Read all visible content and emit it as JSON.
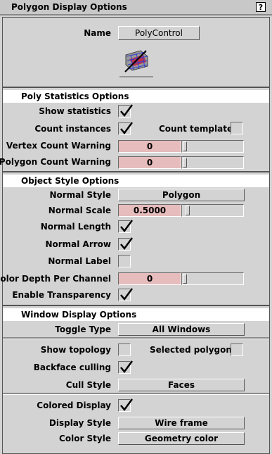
{
  "window": {
    "title": "Polygon Display Options",
    "help_label": "?"
  },
  "name": {
    "label": "Name",
    "value": "PolyControl"
  },
  "poly_stats": {
    "header": "Poly Statistics Options",
    "show_statistics": {
      "label": "Show statistics",
      "checked": true
    },
    "count_instances": {
      "label": "Count instances",
      "checked": true
    },
    "count_templated": {
      "label": "Count templated",
      "checked": false
    },
    "vertex_warning": {
      "label": "Vertex Count Warning",
      "value": "0"
    },
    "polygon_warning": {
      "label": "Polygon Count Warning",
      "value": "0"
    }
  },
  "object_style": {
    "header": "Object Style Options",
    "normal_style": {
      "label": "Normal Style",
      "value": "Polygon"
    },
    "normal_scale": {
      "label": "Normal Scale",
      "value": "0.5000"
    },
    "normal_length": {
      "label": "Normal Length",
      "checked": true
    },
    "normal_arrow": {
      "label": "Normal Arrow",
      "checked": true
    },
    "normal_label": {
      "label": "Normal Label",
      "checked": false
    },
    "color_depth": {
      "label": "Color Depth Per Channel",
      "value": "0"
    },
    "enable_transparency": {
      "label": "Enable Transparency",
      "checked": true
    }
  },
  "window_display": {
    "header": "Window Display Options",
    "toggle_type": {
      "label": "Toggle Type",
      "value": "All Windows"
    },
    "show_topology": {
      "label": "Show topology",
      "checked": false
    },
    "selected_polygons": {
      "label": "Selected polygons",
      "checked": false
    },
    "backface_culling": {
      "label": "Backface culling",
      "checked": true
    },
    "cull_style": {
      "label": "Cull Style",
      "value": "Faces"
    },
    "colored_display": {
      "label": "Colored Display",
      "checked": true
    },
    "display_style": {
      "label": "Display Style",
      "value": "Wire frame"
    },
    "color_style": {
      "label": "Color Style",
      "value": "Geometry color"
    }
  }
}
